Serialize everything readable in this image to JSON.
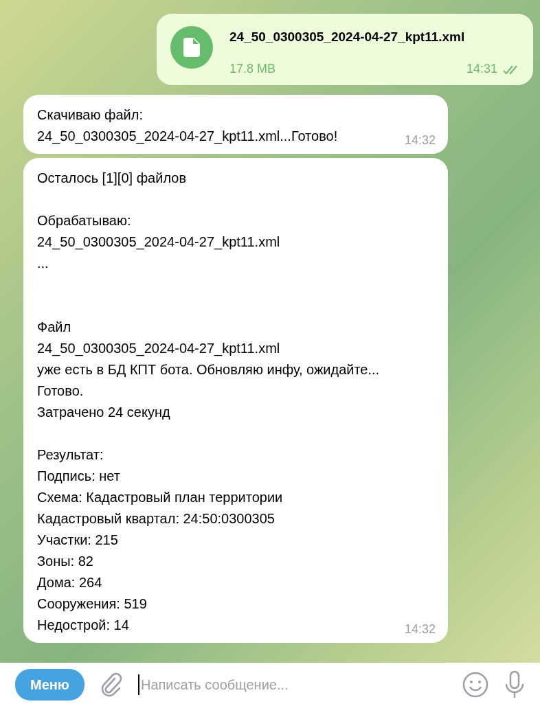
{
  "messages": [
    {
      "kind": "file",
      "outgoing": true,
      "file_name": "24_50_0300305_2024-04-27_kpt11.xml",
      "file_size": "17.8 MB",
      "time": "14:31",
      "read": true
    },
    {
      "kind": "text",
      "outgoing": false,
      "time": "14:32",
      "paragraphs": [
        {
          "kind": "paragraph",
          "lines": [
            "Скачиваю файл:",
            "24_50_0300305_2024-04-27_kpt11.xml...Готово!"
          ]
        }
      ]
    },
    {
      "kind": "text",
      "outgoing": false,
      "time": "14:32",
      "paragraphs": [
        {
          "kind": "paragraph",
          "lines": [
            "Осталось [1][0] файлов"
          ]
        },
        {
          "kind": "paragraph",
          "lines": [
            "Обрабатываю:",
            "24_50_0300305_2024-04-27_kpt11.xml",
            "..."
          ]
        },
        {
          "kind": "section",
          "lines": [
            "Файл",
            "24_50_0300305_2024-04-27_kpt11.xml",
            "уже есть в БД КПТ бота. Обновляю инфу, ожидайте...",
            "Готово.",
            "Затрачено 24 секунд"
          ]
        },
        {
          "kind": "paragraph",
          "lines": [
            "Результат:",
            "Подпись: нет",
            "Схема: Кадастровый план территории",
            "Кадастровый квартал: 24:50:0300305",
            "Участки: 215",
            "Зоны: 82",
            "Дома: 264",
            "Сооружения: 519",
            "Недострой: 14"
          ]
        }
      ]
    }
  ],
  "composer": {
    "menu_button": "Меню",
    "placeholder": "Написать сообщение..."
  }
}
